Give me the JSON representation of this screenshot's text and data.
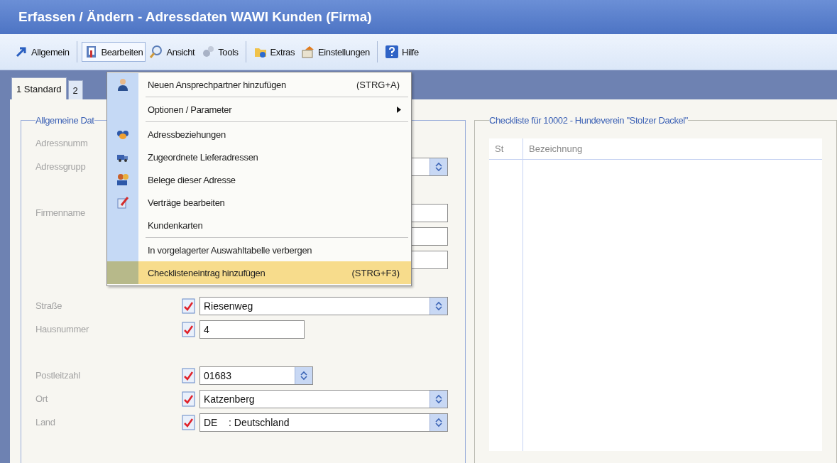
{
  "window": {
    "title": "Erfassen / Ändern - Adressdaten WAWI Kunden (Firma)"
  },
  "toolbar": [
    {
      "kind": "button",
      "label": "Allgemein",
      "selected": false
    },
    {
      "kind": "separator"
    },
    {
      "kind": "button",
      "label": "Bearbeiten",
      "selected": true
    },
    {
      "kind": "button",
      "label": "Ansicht",
      "selected": false
    },
    {
      "kind": "button",
      "label": "Tools",
      "selected": false
    },
    {
      "kind": "separator"
    },
    {
      "kind": "button",
      "label": "Extras",
      "selected": false
    },
    {
      "kind": "button",
      "label": "Einstellungen",
      "selected": false
    },
    {
      "kind": "separator"
    },
    {
      "kind": "button",
      "label": "Hilfe",
      "selected": false
    }
  ],
  "tabs": [
    {
      "label": "1 Standard",
      "selected": true
    },
    {
      "label": "2",
      "selected": false
    }
  ],
  "general_group": {
    "title": "Allgemeine Dat",
    "rows": [
      {
        "kind": "field",
        "label": "Adressnumm"
      },
      {
        "kind": "field",
        "label": "Adressgrupp",
        "fields": [
          {
            "kind": "combo"
          }
        ]
      },
      {
        "kind": "spacer"
      },
      {
        "kind": "field",
        "label": "Firmenname",
        "fields": [
          {
            "kind": "text"
          }
        ]
      },
      {
        "kind": "field",
        "fields": [
          {
            "kind": "text"
          }
        ]
      },
      {
        "kind": "field",
        "fields": [
          {
            "kind": "text"
          }
        ]
      },
      {
        "kind": "spacer"
      },
      {
        "kind": "field",
        "label": "Straße",
        "fields": [
          {
            "kind": "combo",
            "marked": true,
            "value": "Riesenweg"
          }
        ]
      },
      {
        "kind": "field",
        "label": "Hausnummer",
        "fields": [
          {
            "kind": "text",
            "marked": true,
            "value": "4"
          }
        ]
      },
      {
        "kind": "spacer"
      },
      {
        "kind": "field",
        "label": "Postleitzahl",
        "fields": [
          {
            "kind": "combo",
            "marked": true,
            "value": "01683"
          }
        ]
      },
      {
        "kind": "field",
        "label": "Ort",
        "fields": [
          {
            "kind": "combo",
            "marked": true,
            "value": "Katzenberg"
          }
        ]
      },
      {
        "kind": "field",
        "label": "Land",
        "fields": [
          {
            "kind": "combo",
            "marked": true,
            "value": "DE    : Deutschland"
          }
        ]
      }
    ]
  },
  "checklist_group": {
    "title": "Checkliste für 10002 - Hundeverein \"Stolzer Dackel\"",
    "columns": [
      "St",
      "Bezeichnung"
    ]
  },
  "menu": [
    {
      "kind": "item",
      "label": "Neuen Ansprechpartner hinzufügen",
      "shortcut": "(STRG+A)",
      "submenu": false,
      "selected": false
    },
    {
      "kind": "separator"
    },
    {
      "kind": "item",
      "label": "Optionen / Parameter",
      "submenu": true,
      "selected": false
    },
    {
      "kind": "separator"
    },
    {
      "kind": "item",
      "label": "Adressbeziehungen",
      "submenu": false,
      "selected": false
    },
    {
      "kind": "item",
      "label": "Zugeordnete Lieferadressen",
      "submenu": false,
      "selected": false
    },
    {
      "kind": "item",
      "label": "Belege dieser Adresse",
      "submenu": false,
      "selected": false
    },
    {
      "kind": "item",
      "label": "Verträge bearbeiten",
      "submenu": false,
      "selected": false
    },
    {
      "kind": "item",
      "label": "Kundenkarten",
      "submenu": false,
      "selected": false
    },
    {
      "kind": "separator"
    },
    {
      "kind": "item",
      "label": "In vorgelagerter Auswahltabelle verbergen",
      "submenu": false,
      "selected": false
    },
    {
      "kind": "item",
      "label": "Checklisteneintrag hinzufügen",
      "shortcut": "(STRG+F3)",
      "submenu": false,
      "selected": true
    }
  ]
}
